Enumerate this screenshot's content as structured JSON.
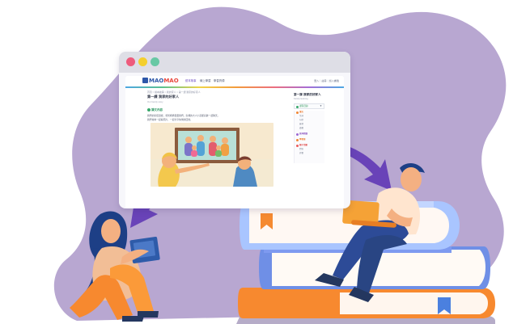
{
  "browser": {
    "logo": {
      "brand": "MAO",
      "accent": "MAO"
    },
    "nav_links": [
      "繪本故事",
      "線上學習",
      "學習資源"
    ],
    "nav_right": "登入｜註冊｜加入書籤",
    "breadcrumb": "首頁 > 繪本故事 > 我的家人 > 第一課 我家的好家人",
    "article": {
      "title": "第一課 我家的好家人",
      "subtitle": "Our family story",
      "section": "課文內容",
      "body_lines": [
        "我們的家很溫暖，爸爸媽媽很愛我們，家裡的大人小孩都喜歡一起聊天。",
        "我們常常一起看照片，一起分享快樂的回憶。"
      ]
    },
    "sidebar": {
      "title": "第一課 我家的好家人",
      "subtitle": "Family learning",
      "select_value": "課程目錄",
      "menu_items": [
        "課文",
        "生詞",
        "句型",
        "練習",
        "遊戲",
        "延伸閱讀",
        "學習單",
        "親子活動",
        "問答",
        "評量"
      ]
    }
  },
  "colors": {
    "blob": "#b8a7d1",
    "browser_frame": "#dedee6",
    "accent_purple": "#6943b8",
    "book_orange": "#f7892f",
    "book_blue": "#6f8fe6",
    "book_light_blue": "#a9c5ff",
    "laptop_orange": "#f5a236"
  },
  "icons": [
    "close-window-icon",
    "minimize-window-icon",
    "maximize-window-icon",
    "arrow-icon",
    "bookmark-icon"
  ]
}
